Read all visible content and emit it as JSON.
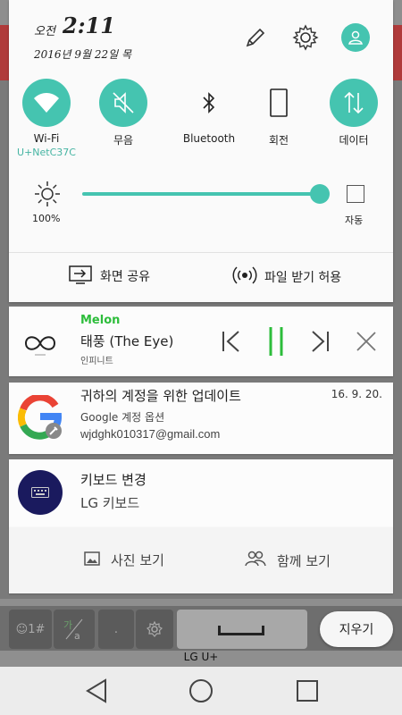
{
  "status": {
    "ampm": "오전",
    "time": "2:11",
    "date": "2016년 9월 22일 목"
  },
  "top_icons": [
    "edit-icon",
    "settings-icon",
    "account-icon"
  ],
  "quick_settings": [
    {
      "label": "Wi-Fi",
      "sub": "U+NetC37C",
      "icon": "wifi-icon",
      "active": true
    },
    {
      "label": "무음",
      "sub": "",
      "icon": "mute-icon",
      "active": true
    },
    {
      "label": "Bluetooth",
      "sub": "",
      "icon": "bluetooth-icon",
      "active": false
    },
    {
      "label": "회전",
      "sub": "",
      "icon": "rotate-icon",
      "active": false
    },
    {
      "label": "데이터",
      "sub": "",
      "icon": "data-icon",
      "active": true
    }
  ],
  "brightness": {
    "value": 100,
    "percent_label": "100%",
    "auto_label": "자동"
  },
  "shortcuts": {
    "screen_share": "화면 공유",
    "file_receive": "파일 받기 허용"
  },
  "music": {
    "app": "Melon",
    "title": "태풍 (The Eye)",
    "artist": "인피니트"
  },
  "google_notification": {
    "title": "귀하의 계정을 위한 업데이트",
    "subtitle": "Google 계정 옵션",
    "email": "wjdghk010317@gmail.com",
    "time": "16. 9. 20."
  },
  "keyboard_notification": {
    "title": "키보드 변경",
    "subtitle": "LG 키보드"
  },
  "actions": {
    "view_photos": "사진 보기",
    "view_together": "함께 보기"
  },
  "keyboard": {
    "emoji_key": "☺1#",
    "clear_button": "지우기"
  },
  "carrier": "LG U+",
  "colors": {
    "accent": "#45c4b0",
    "melon_green": "#2dbd3b",
    "pause_green": "#2dbd3b"
  }
}
